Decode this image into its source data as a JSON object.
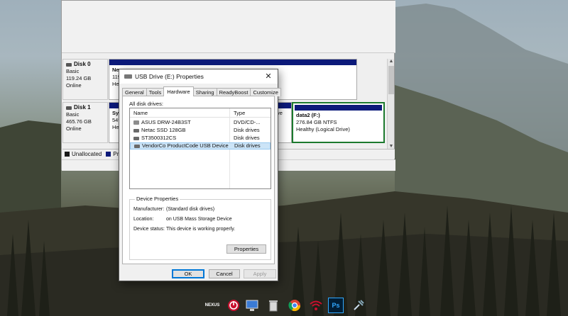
{
  "desktop": {
    "background": "mountain-forest-landscape"
  },
  "disk_management": {
    "disks": [
      {
        "name": "Disk 0",
        "type": "Basic",
        "size": "119.24 GB",
        "status": "Online",
        "partitions": [
          {
            "line1": "Ne",
            "line2": "119",
            "line3": "He"
          }
        ]
      },
      {
        "name": "Disk 1",
        "type": "Basic",
        "size": "465.76 GB",
        "status": "Online",
        "partitions": [
          {
            "line1": "Sys",
            "line2": "549",
            "line3": "He"
          },
          {
            "line1": "",
            "line2": "",
            "line3": "ve"
          },
          {
            "line1": "data2  (F:)",
            "line2": "276.84 GB NTFS",
            "line3": "Healthy (Logical Drive)"
          }
        ]
      }
    ],
    "legend": [
      {
        "label": "Unallocated",
        "color": "#1a1a1a"
      },
      {
        "label": "Prim",
        "color": "#0c1a7a"
      }
    ],
    "scroll_up": "▲",
    "scroll_down": "▼"
  },
  "dialog": {
    "title": "USB Drive (E:) Properties",
    "close_glyph": "✕",
    "tabs": [
      "General",
      "Tools",
      "Hardware",
      "Sharing",
      "ReadyBoost",
      "Customize"
    ],
    "active_tab": "Hardware",
    "all_disk_drives_label": "All disk drives:",
    "columns": {
      "name": "Name",
      "type": "Type"
    },
    "drives": [
      {
        "name": "ASUS DRW-24B3ST",
        "type": "DVD/CD-...",
        "icon": "dvd-drive-icon"
      },
      {
        "name": "Netac SSD 128GB",
        "type": "Disk drives",
        "icon": "disk-drive-icon"
      },
      {
        "name": "ST3500312CS",
        "type": "Disk drives",
        "icon": "disk-drive-icon"
      },
      {
        "name": "VendorCo ProductCode USB Device",
        "type": "Disk drives",
        "icon": "usb-drive-icon"
      }
    ],
    "selected_drive_index": 3,
    "device_properties": {
      "title": "Device Properties",
      "manufacturer_label": "Manufacturer:",
      "manufacturer": "(Standard disk drives)",
      "location_label": "Location:",
      "location": "on USB Mass Storage Device",
      "status_label": "Device status:",
      "status": "This device is working properly.",
      "properties_button": "Properties"
    },
    "buttons": {
      "ok": "OK",
      "cancel": "Cancel",
      "apply": "Apply"
    }
  },
  "taskbar": {
    "icons": [
      {
        "name": "nexus-dock-icon",
        "label": "NEXUS"
      },
      {
        "name": "power-icon",
        "label": ""
      },
      {
        "name": "computer-icon",
        "label": ""
      },
      {
        "name": "recycle-bin-icon",
        "label": ""
      },
      {
        "name": "chrome-icon",
        "label": ""
      },
      {
        "name": "wifi-icon",
        "label": ""
      },
      {
        "name": "photoshop-icon",
        "label": "Ps"
      },
      {
        "name": "tool-icon",
        "label": ""
      }
    ]
  }
}
